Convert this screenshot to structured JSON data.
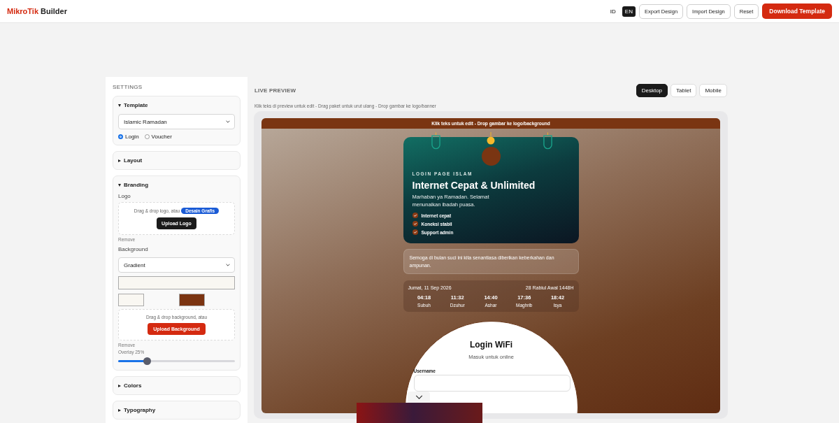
{
  "header": {
    "brand_accent": "MikroTik",
    "brand_rest": "Builder",
    "languages": [
      {
        "label": "ID",
        "selected": false
      },
      {
        "label": "EN",
        "selected": true
      }
    ],
    "buttons": [
      {
        "label": "Export Design",
        "kind": "outline"
      },
      {
        "label": "Import Design",
        "kind": "outline"
      },
      {
        "label": "Reset",
        "kind": "outline"
      },
      {
        "label": "Download Template",
        "kind": "primary"
      }
    ]
  },
  "settings": {
    "title": "SETTINGS",
    "sections": [
      {
        "kind": "template",
        "title": "Template",
        "expanded": true,
        "select": "Islamic Ramadan",
        "modes": [
          {
            "label": "Login",
            "selected": true
          },
          {
            "label": "Voucher",
            "selected": false
          }
        ]
      },
      {
        "title": "Layout",
        "expanded": false
      },
      {
        "kind": "branding",
        "title": "Branding",
        "expanded": true,
        "logo_label": "Logo",
        "logo_drop_text": "Drag & drop logo, atau",
        "logo_badge": "Desain Grafis",
        "upload_logo": "Upload Logo",
        "logo_remove": "Remove",
        "background_label": "Background",
        "background_select": "Gradient",
        "swatches": [
          {
            "color": "#f9f7f2"
          },
          {
            "color": "#7b3411"
          }
        ],
        "bg_drop_text": "Drag & drop background, atau",
        "upload_background": "Upload Background",
        "bg_remove": "Remove",
        "overlay_label": "Overlay 25%",
        "overlay": {
          "level": 0.25
        }
      },
      {
        "title": "Colors",
        "expanded": false
      },
      {
        "title": "Typography",
        "expanded": false
      }
    ]
  },
  "preview": {
    "title": "LIVE PREVIEW",
    "hint": "Klik teks di preview untuk edit - Drag paket untuk urut ulang - Drop gambar ke logo/banner",
    "devices": [
      {
        "label": "Desktop",
        "selected": true
      },
      {
        "label": "Tablet",
        "selected": false
      },
      {
        "label": "Mobile",
        "selected": false
      }
    ],
    "banner": "Klik teks untuk edit - Drop gambar ke logo/background",
    "hero": {
      "eyebrow": "LOGIN PAGE ISLAM",
      "title": "Internet Cepat & Unlimited",
      "subtitle": "Marhaban ya Ramadan. Selamat menunaikan ibadah puasa.",
      "features": [
        "Internet cepat",
        "Koneksi stabil",
        "Support admin"
      ]
    },
    "message": "Semoga di bulan suci ini kita senantiasa diberikan keberkahan dan ampunan.",
    "prayer": {
      "date": "Jumat, 11 Sep 2026",
      "hijri": "28 Rabiul Awal 1448H",
      "times": [
        {
          "time": "04:18",
          "name": "Subuh"
        },
        {
          "time": "11:32",
          "name": "Dzuhur"
        },
        {
          "time": "14:40",
          "name": "Ashar"
        },
        {
          "time": "17:36",
          "name": "Maghrib"
        },
        {
          "time": "18:42",
          "name": "Isya"
        }
      ]
    },
    "login": {
      "title": "Login WiFi",
      "subtitle": "Masuk untuk online",
      "username_label": "Username"
    }
  }
}
